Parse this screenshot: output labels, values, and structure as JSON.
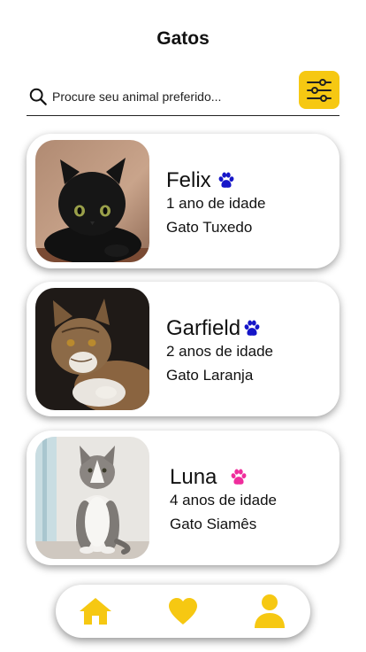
{
  "header": {
    "title": "Gatos"
  },
  "search": {
    "placeholder": "Procure seu animal preferido..."
  },
  "colors": {
    "accent": "#f6c812",
    "paw_blue": "#1515c8",
    "paw_pink": "#ef2d9c"
  },
  "pets": [
    {
      "name": "Felix",
      "age": "1 ano de idade",
      "breed": "Gato Tuxedo",
      "paw_icon": "paw-icon",
      "paw_color": "blue"
    },
    {
      "name": "Garfield",
      "age": "2 anos de idade",
      "breed": "Gato Laranja",
      "paw_icon": "paw-icon",
      "paw_color": "blue"
    },
    {
      "name": "Luna",
      "age": "4 anos de idade",
      "breed": "Gato Siamês",
      "paw_icon": "paw-icon",
      "paw_color": "pink"
    }
  ],
  "nav": {
    "items": [
      {
        "icon": "home-icon"
      },
      {
        "icon": "heart-icon"
      },
      {
        "icon": "user-icon"
      }
    ]
  }
}
